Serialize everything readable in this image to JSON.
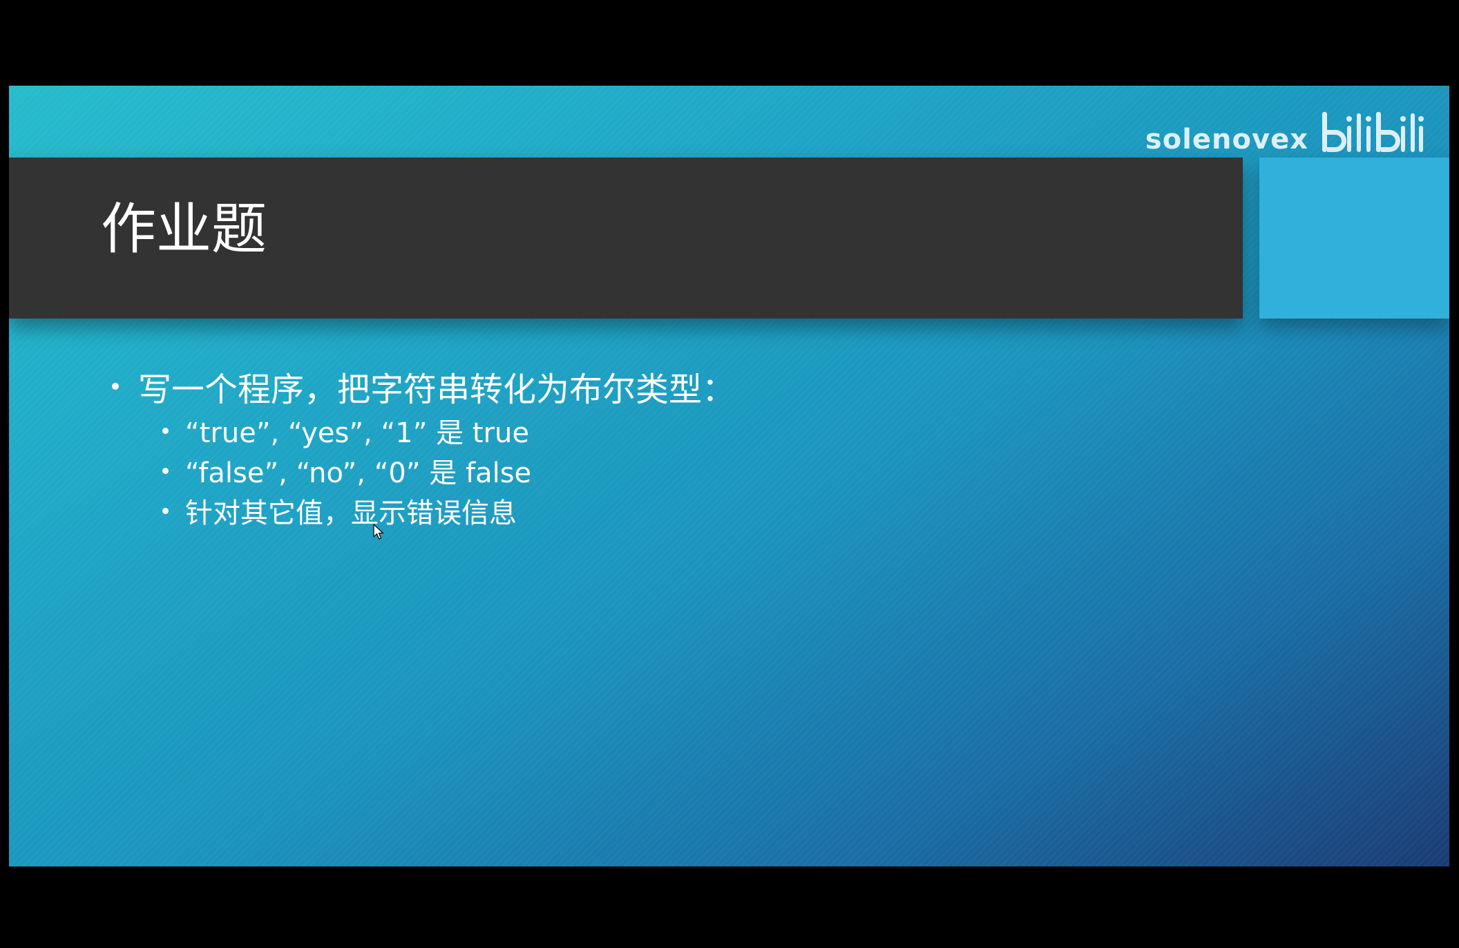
{
  "watermark": {
    "username": "solenovex",
    "logo_icon": "bilibili-logo"
  },
  "slide": {
    "title": "作业题",
    "bullets": [
      {
        "text": "写一个程序，把字符串转化为布尔类型：",
        "children": [
          "“true”, “yes”, “1” 是 true",
          "“false”, “no”, “0” 是 false",
          "针对其它值，显示错误信息"
        ]
      }
    ]
  },
  "overlay": {
    "play_icon": "bilibili-tv-play-icon",
    "cursor_icon": "mouse-cursor-icon"
  },
  "colors": {
    "title_bar": "#333333",
    "accent_square": "#2fb1dc",
    "gradient_start": "#26bccd",
    "gradient_end": "#1b3c74",
    "text": "#ffffff"
  }
}
